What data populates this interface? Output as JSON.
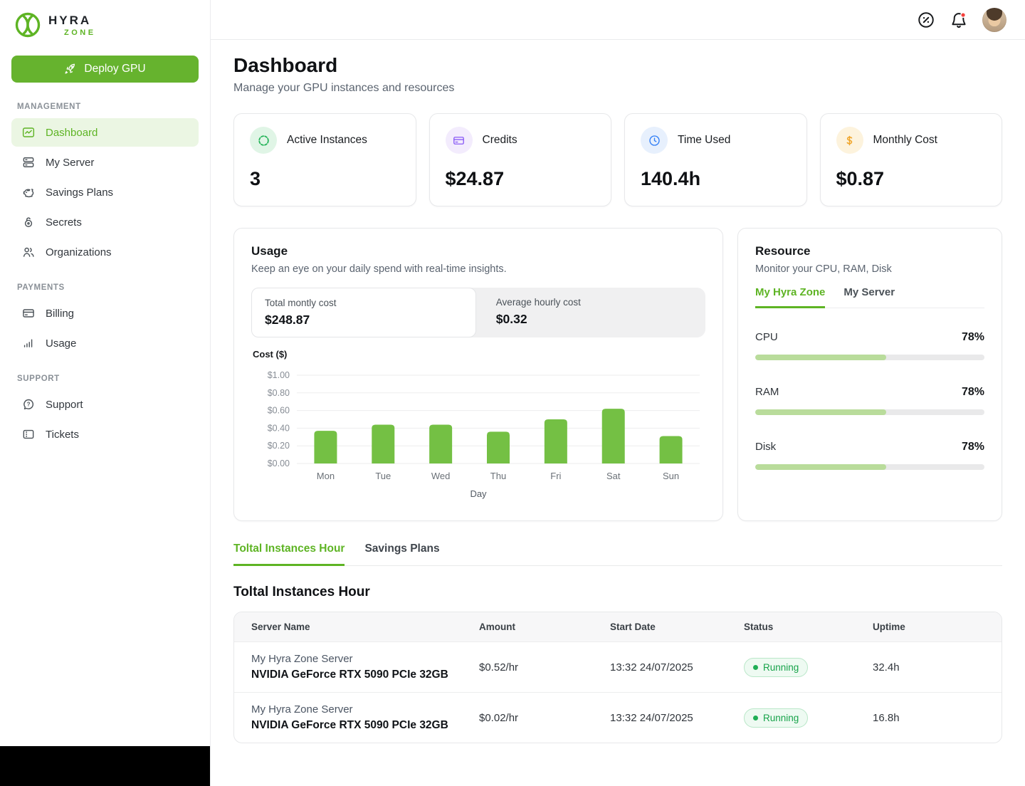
{
  "brand": {
    "name": "HYRA",
    "subname": "ZONE",
    "accent_color": "#5eb424"
  },
  "topbar": {
    "icons": [
      "discount-badge-icon",
      "notification-bell-icon"
    ],
    "has_notification_dot": true
  },
  "sidebar": {
    "deploy_button_label": "Deploy GPU",
    "sections": [
      {
        "label": "MANAGEMENT",
        "items": [
          {
            "label": "Dashboard",
            "icon": "dashboard-icon",
            "active": true
          },
          {
            "label": "My Server",
            "icon": "server-icon",
            "active": false
          },
          {
            "label": "Savings Plans",
            "icon": "piggy-bank-icon",
            "active": false
          },
          {
            "label": "Secrets",
            "icon": "lock-icon",
            "active": false
          },
          {
            "label": "Organizations",
            "icon": "people-icon",
            "active": false
          }
        ]
      },
      {
        "label": "PAYMENTS",
        "items": [
          {
            "label": "Billing",
            "icon": "credit-card-icon",
            "active": false
          },
          {
            "label": "Usage",
            "icon": "bar-chart-icon",
            "active": false
          }
        ]
      },
      {
        "label": "SUPPORT",
        "items": [
          {
            "label": "Support",
            "icon": "help-chat-icon",
            "active": false
          },
          {
            "label": "Tickets",
            "icon": "ticket-icon",
            "active": false
          }
        ]
      }
    ]
  },
  "page": {
    "title": "Dashboard",
    "subtitle": "Manage your GPU instances and resources"
  },
  "stats": [
    {
      "label": "Active Instances",
      "value": "3",
      "icon": "instances-circle-icon",
      "icon_color": "#22b357",
      "icon_bg": "#e0f5e6"
    },
    {
      "label": "Credits",
      "value": "$24.87",
      "icon": "credit-card-icon",
      "icon_color": "#8b5cf6",
      "icon_bg": "#f3ecfd"
    },
    {
      "label": "Time Used",
      "value": "140.4h",
      "icon": "clock-icon",
      "icon_color": "#2f7df6",
      "icon_bg": "#e7f0fd"
    },
    {
      "label": "Monthly Cost",
      "value": "$0.87",
      "icon": "dollar-icon",
      "icon_color": "#f0a529",
      "icon_bg": "#fdf3dd"
    }
  ],
  "usage_panel": {
    "title": "Usage",
    "subtitle": "Keep an eye on your daily spend with real-time insights.",
    "total_monthly_label": "Total montly cost",
    "total_monthly_value": "$248.87",
    "avg_hourly_label": "Average hourly cost",
    "avg_hourly_value": "$0.32"
  },
  "chart_data": {
    "type": "bar",
    "categories": [
      "Mon",
      "Tue",
      "Wed",
      "Thu",
      "Fri",
      "Sat",
      "Sun"
    ],
    "values": [
      0.37,
      0.44,
      0.44,
      0.36,
      0.5,
      0.62,
      0.31
    ],
    "title": "",
    "xlabel": "Day",
    "ylabel": "Cost ($)",
    "ylim": [
      0,
      1.0
    ],
    "yticks": [
      "$1.00",
      "$0.80",
      "$0.60",
      "$0.40",
      "$0.20",
      "$0.00"
    ],
    "bar_color": "#74c044",
    "grid": true,
    "legend": "none"
  },
  "resource_panel": {
    "title": "Resource",
    "subtitle": "Monitor your CPU, RAM, Disk",
    "tabs": [
      {
        "label": "My Hyra Zone",
        "active": true
      },
      {
        "label": "My Server",
        "active": false
      }
    ],
    "meters": [
      {
        "label": "CPU",
        "value": "78%",
        "bar_fill": 57
      },
      {
        "label": "RAM",
        "value": "78%",
        "bar_fill": 57
      },
      {
        "label": "Disk",
        "value": "78%",
        "bar_fill": 57
      }
    ]
  },
  "instances_section": {
    "tabs": [
      {
        "label": "Toltal Instances Hour",
        "active": true
      },
      {
        "label": "Savings Plans",
        "active": false
      }
    ],
    "heading": "Toltal Instances Hour",
    "table": {
      "headers": [
        "Server Name",
        "Amount",
        "Start Date",
        "Status",
        "Uptime"
      ],
      "rows": [
        {
          "server_name": "My Hyra Zone Server",
          "server_gpu": "NVIDIA GeForce RTX 5090 PCIe 32GB",
          "amount": "$0.52/hr",
          "start_date": "13:32 24/07/2025",
          "status": "Running",
          "uptime": "32.4h"
        },
        {
          "server_name": "My Hyra Zone Server",
          "server_gpu": "NVIDIA GeForce RTX 5090 PCIe 32GB",
          "amount": "$0.02/hr",
          "start_date": "13:32 24/07/2025",
          "status": "Running",
          "uptime": "16.8h"
        }
      ]
    }
  }
}
